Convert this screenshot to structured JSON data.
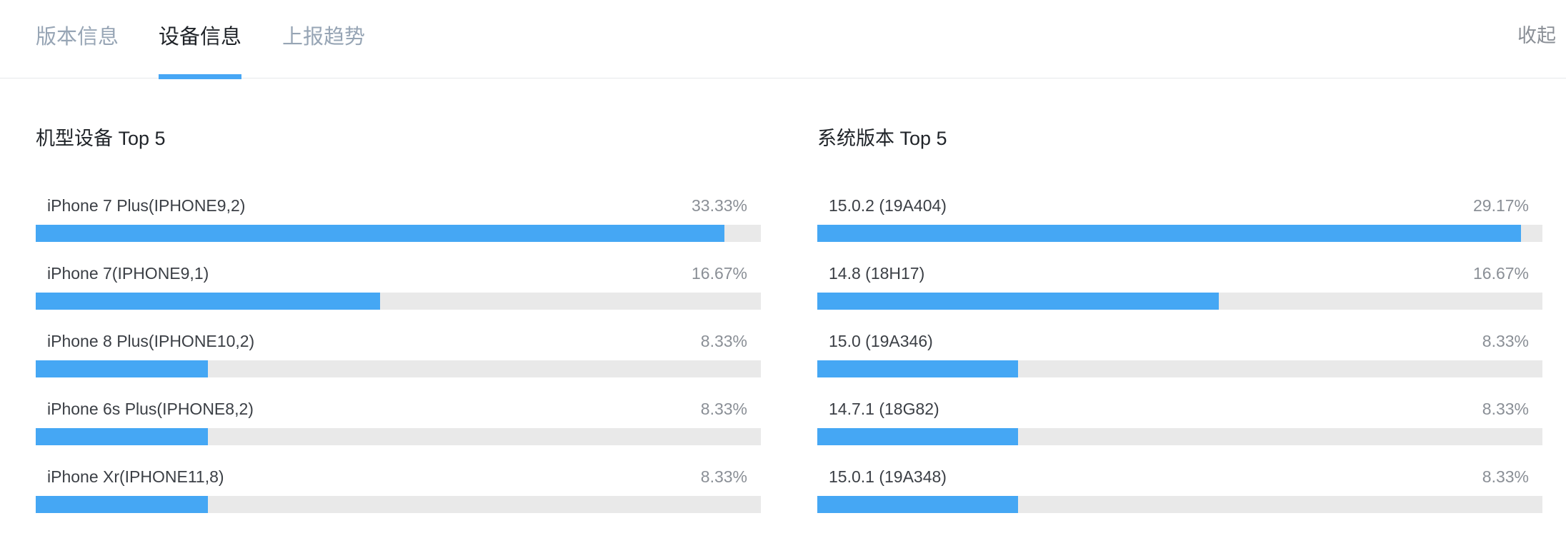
{
  "tabs": [
    {
      "label": "版本信息",
      "active": false
    },
    {
      "label": "设备信息",
      "active": true
    },
    {
      "label": "上报趋势",
      "active": false
    }
  ],
  "collapse_label": "收起",
  "colors": {
    "accent": "#45a7f4",
    "track": "#e9e9e9",
    "tab_inactive": "#97a5b5",
    "text_primary": "#1f2328",
    "text_muted": "#8a8f96"
  },
  "device_panel": {
    "title": "机型设备 Top 5",
    "items": [
      {
        "label": "iPhone 7 Plus(IPHONE9,2)",
        "percent": "33.33%",
        "fill": 0.95
      },
      {
        "label": "iPhone 7(IPHONE9,1)",
        "percent": "16.67%",
        "fill": 0.475
      },
      {
        "label": "iPhone 8 Plus(IPHONE10,2)",
        "percent": "8.33%",
        "fill": 0.2375
      },
      {
        "label": "iPhone 6s Plus(IPHONE8,2)",
        "percent": "8.33%",
        "fill": 0.2375
      },
      {
        "label": "iPhone Xr(IPHONE11,8)",
        "percent": "8.33%",
        "fill": 0.2375
      }
    ]
  },
  "os_panel": {
    "title": "系统版本 Top 5",
    "items": [
      {
        "label": "15.0.2 (19A404)",
        "percent": "29.17%",
        "fill": 0.97
      },
      {
        "label": "14.8 (18H17)",
        "percent": "16.67%",
        "fill": 0.554
      },
      {
        "label": "15.0 (19A346)",
        "percent": "8.33%",
        "fill": 0.277
      },
      {
        "label": "14.7.1 (18G82)",
        "percent": "8.33%",
        "fill": 0.277
      },
      {
        "label": "15.0.1 (19A348)",
        "percent": "8.33%",
        "fill": 0.277
      }
    ]
  }
}
